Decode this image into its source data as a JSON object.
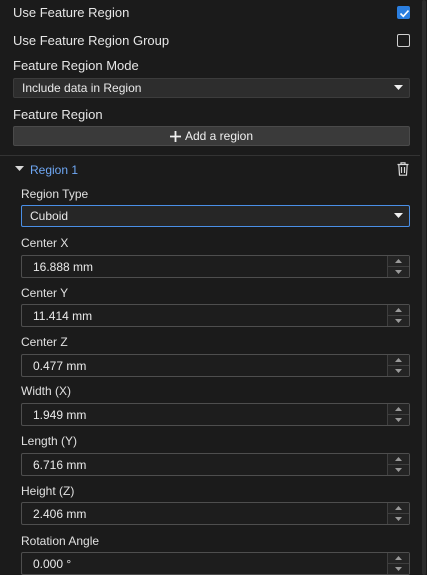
{
  "use_feature_region": {
    "label": "Use Feature Region",
    "checked": true
  },
  "use_feature_region_group": {
    "label": "Use Feature Region Group",
    "checked": false
  },
  "feature_region_mode": {
    "label": "Feature Region Mode",
    "value": "Include data in Region"
  },
  "feature_region": {
    "label": "Feature Region",
    "add_button": "Add a region"
  },
  "region": {
    "title": "Region 1",
    "region_type": {
      "label": "Region Type",
      "value": "Cuboid"
    },
    "fields": [
      {
        "label": "Center X",
        "value": "16.888 mm"
      },
      {
        "label": "Center Y",
        "value": "11.414 mm"
      },
      {
        "label": "Center Z",
        "value": "0.477 mm"
      },
      {
        "label": "Width (X)",
        "value": "1.949 mm"
      },
      {
        "label": "Length (Y)",
        "value": "6.716 mm"
      },
      {
        "label": "Height (Z)",
        "value": "2.406 mm"
      },
      {
        "label": "Rotation Angle",
        "value": "0.000 °"
      }
    ]
  },
  "colors": {
    "accent": "#2b7fe0",
    "link": "#6fa8f5",
    "background": "#1b1b1b"
  }
}
